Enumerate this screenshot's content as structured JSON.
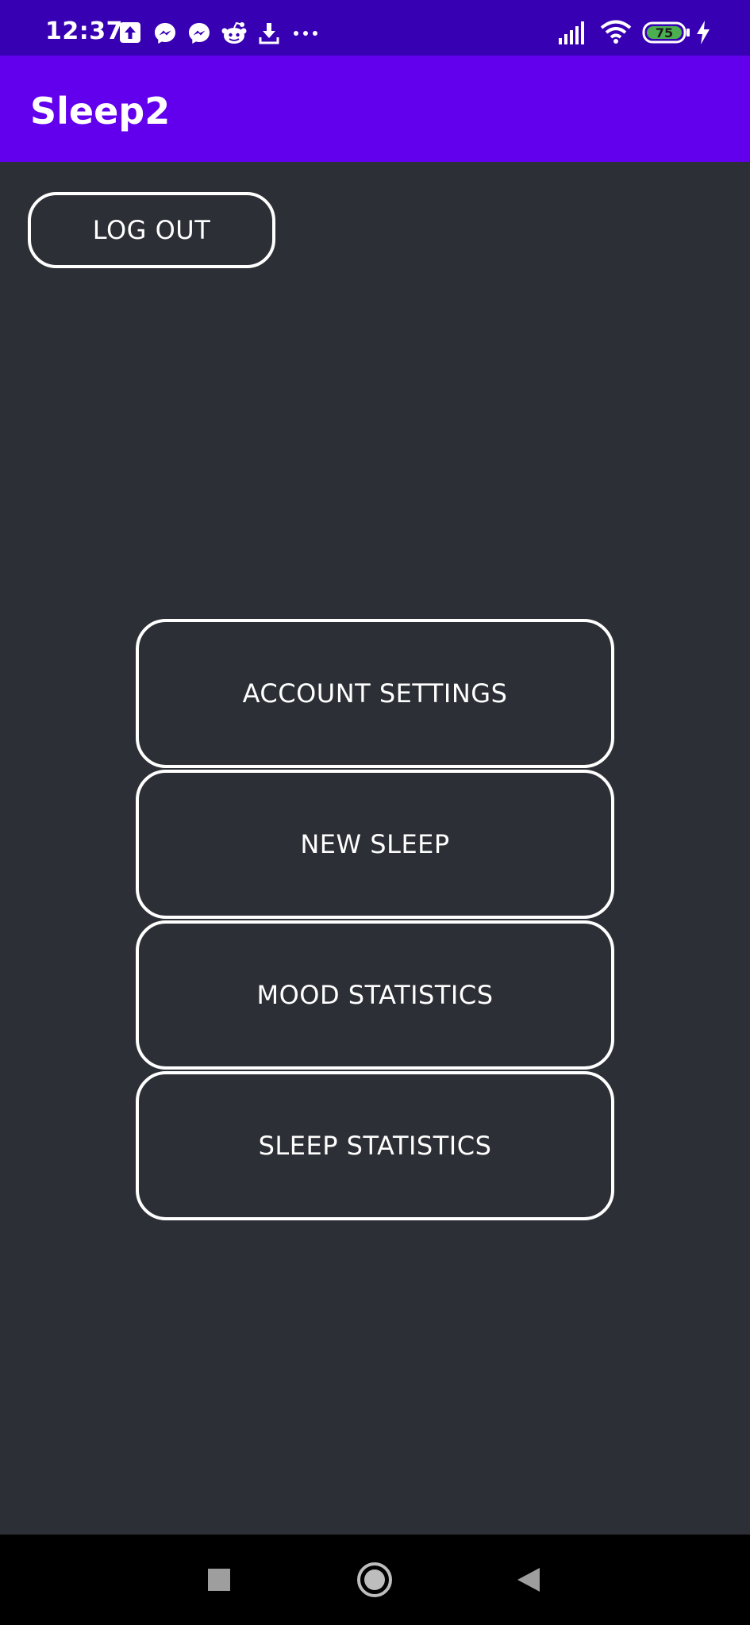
{
  "status_bar": {
    "time": "12:37",
    "battery_level": "75",
    "left_icons": [
      "upload-icon",
      "messenger-icon",
      "messenger-icon",
      "reddit-icon",
      "download-icon",
      "more-dots-icon"
    ],
    "right_icons": [
      "signal-icon",
      "wifi-icon",
      "battery-icon",
      "charging-bolt-icon"
    ],
    "battery_color": "#4caf50"
  },
  "app_bar": {
    "title": "Sleep2",
    "color": "#6200ee"
  },
  "actions": {
    "logout_label": "LOG OUT"
  },
  "menu": {
    "items": [
      {
        "label": "ACCOUNT SETTINGS"
      },
      {
        "label": "NEW SLEEP"
      },
      {
        "label": "MOOD STATISTICS"
      },
      {
        "label": "SLEEP STATISTICS"
      }
    ]
  },
  "nav_bar": {
    "icons": [
      "recents-square-icon",
      "home-circle-icon",
      "back-triangle-icon"
    ]
  },
  "colors": {
    "background": "#2c2f35",
    "status_bar": "#3700b3",
    "button_border": "#ffffff"
  }
}
